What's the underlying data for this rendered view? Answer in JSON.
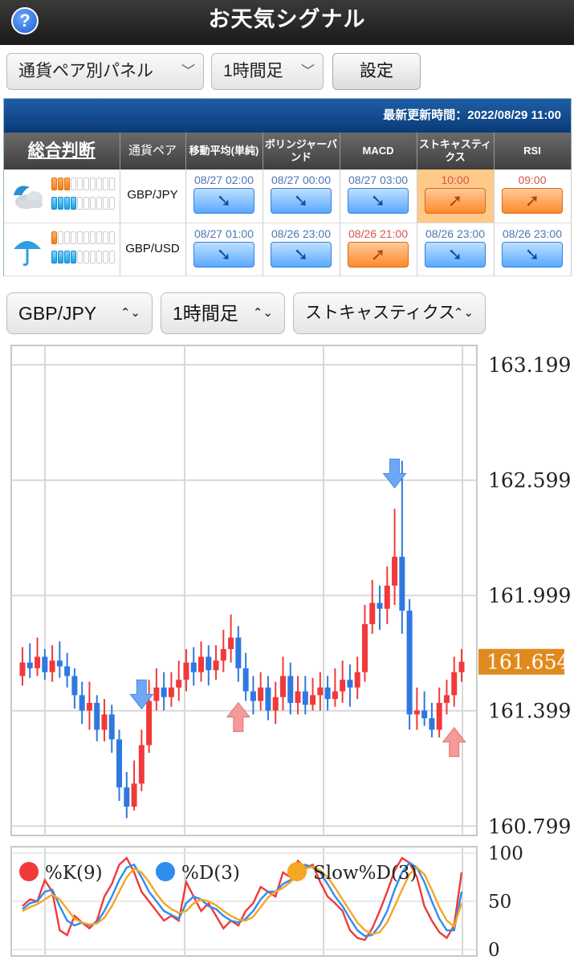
{
  "header": {
    "title": "お天気シグナル",
    "help_icon": "question-circle-icon",
    "help_glyph": "?"
  },
  "controls": {
    "view_select": "通貨ペア別パネル",
    "timeframe_select": "1時間足",
    "settings_label": "設定",
    "chevron": "﹀"
  },
  "panel": {
    "update_text": "最新更新時間：2022/08/29 11:00",
    "headers": [
      "総合判断",
      "通貨ペア",
      "移動平均(単純)",
      "ボリンジャーバンド",
      "MACD",
      "ストキャスティクス",
      "RSI"
    ],
    "rows": [
      {
        "weather": "cloudy-icon",
        "meter_orange": 3,
        "meter_blue": 4,
        "meter_total": 10,
        "pair": "GBP/JPY",
        "signals": [
          {
            "time": "08/27 02:00",
            "dir": "down",
            "highlight": false
          },
          {
            "time": "08/27 00:00",
            "dir": "down",
            "highlight": false
          },
          {
            "time": "08/27 03:00",
            "dir": "down",
            "highlight": false
          },
          {
            "time": "10:00",
            "dir": "up",
            "highlight": true
          },
          {
            "time": "09:00",
            "dir": "up",
            "highlight": false
          }
        ]
      },
      {
        "weather": "umbrella-icon",
        "meter_orange": 1,
        "meter_blue": 4,
        "meter_total": 10,
        "pair": "GBP/USD",
        "signals": [
          {
            "time": "08/27 01:00",
            "dir": "down",
            "highlight": false
          },
          {
            "time": "08/26 23:00",
            "dir": "down",
            "highlight": false
          },
          {
            "time": "08/26 21:00",
            "dir": "up",
            "highlight": false
          },
          {
            "time": "08/26 23:00",
            "dir": "down",
            "highlight": false
          },
          {
            "time": "08/26 23:00",
            "dir": "down",
            "highlight": false
          }
        ]
      }
    ],
    "arrow_down": "➘",
    "arrow_up": "➚"
  },
  "chart_controls": {
    "pair_select": "GBP/JPY",
    "timeframe_select": "1時間足",
    "indicator_select": "ストキャスティクス",
    "updown": "⌃⌄"
  },
  "colors": {
    "up": "#f03a3a",
    "down": "#2f78e0",
    "k_line": "#f03a3a",
    "d_line": "#2f8df0",
    "slow_d_line": "#f5a623",
    "current_price_bg": "#e08a1e"
  },
  "chart_data": [
    {
      "type": "candlestick",
      "title": "",
      "y_ticks": [
        163.199,
        162.599,
        161.999,
        161.399,
        160.799
      ],
      "ylim": [
        160.75,
        163.3
      ],
      "current_price": 161.654,
      "candles": [
        [
          161.58,
          161.65,
          161.53,
          161.73
        ],
        [
          161.65,
          161.62,
          161.57,
          161.75
        ],
        [
          161.62,
          161.68,
          161.58,
          161.78
        ],
        [
          161.68,
          161.6,
          161.56,
          161.72
        ],
        [
          161.6,
          161.66,
          161.55,
          161.74
        ],
        [
          161.66,
          161.63,
          161.57,
          161.76
        ],
        [
          161.63,
          161.58,
          161.52,
          161.7
        ],
        [
          161.58,
          161.48,
          161.41,
          161.62
        ],
        [
          161.48,
          161.4,
          161.33,
          161.55
        ],
        [
          161.4,
          161.44,
          161.3,
          161.55
        ],
        [
          161.44,
          161.3,
          161.24,
          161.48
        ],
        [
          161.3,
          161.38,
          161.24,
          161.46
        ],
        [
          161.38,
          161.25,
          161.18,
          161.43
        ],
        [
          161.25,
          161.0,
          160.93,
          161.3
        ],
        [
          161.0,
          160.9,
          160.84,
          161.08
        ],
        [
          160.9,
          161.02,
          160.88,
          161.14
        ],
        [
          161.02,
          161.22,
          160.98,
          161.3
        ],
        [
          161.22,
          161.45,
          161.18,
          161.56
        ],
        [
          161.45,
          161.52,
          161.4,
          161.62
        ],
        [
          161.52,
          161.47,
          161.4,
          161.6
        ],
        [
          161.47,
          161.52,
          161.42,
          161.6
        ],
        [
          161.52,
          161.56,
          161.45,
          161.66
        ],
        [
          161.56,
          161.65,
          161.5,
          161.72
        ],
        [
          161.65,
          161.6,
          161.53,
          161.73
        ],
        [
          161.6,
          161.68,
          161.55,
          161.76
        ],
        [
          161.68,
          161.61,
          161.53,
          161.74
        ],
        [
          161.61,
          161.66,
          161.56,
          161.74
        ],
        [
          161.66,
          161.72,
          161.6,
          161.82
        ],
        [
          161.72,
          161.78,
          161.65,
          161.9
        ],
        [
          161.78,
          161.62,
          161.55,
          161.84
        ],
        [
          161.62,
          161.5,
          161.45,
          161.7
        ],
        [
          161.5,
          161.45,
          161.38,
          161.58
        ],
        [
          161.45,
          161.52,
          161.4,
          161.6
        ],
        [
          161.52,
          161.4,
          161.35,
          161.58
        ],
        [
          161.4,
          161.47,
          161.33,
          161.55
        ],
        [
          161.47,
          161.58,
          161.4,
          161.68
        ],
        [
          161.58,
          161.44,
          161.38,
          161.65
        ],
        [
          161.44,
          161.5,
          161.38,
          161.58
        ],
        [
          161.5,
          161.43,
          161.38,
          161.58
        ],
        [
          161.43,
          161.48,
          161.4,
          161.57
        ],
        [
          161.48,
          161.52,
          161.4,
          161.6
        ],
        [
          161.52,
          161.46,
          161.4,
          161.58
        ],
        [
          161.46,
          161.5,
          161.42,
          161.62
        ],
        [
          161.5,
          161.56,
          161.44,
          161.66
        ],
        [
          161.56,
          161.52,
          161.42,
          161.64
        ],
        [
          161.52,
          161.6,
          161.46,
          161.68
        ],
        [
          161.6,
          161.85,
          161.55,
          161.95
        ],
        [
          161.85,
          161.96,
          161.8,
          162.08
        ],
        [
          161.96,
          161.93,
          161.82,
          162.05
        ],
        [
          161.93,
          162.05,
          161.85,
          162.15
        ],
        [
          162.05,
          162.2,
          161.95,
          162.45
        ],
        [
          162.2,
          161.92,
          161.8,
          162.7
        ],
        [
          161.92,
          161.38,
          161.3,
          161.98
        ],
        [
          161.38,
          161.4,
          161.3,
          161.52
        ],
        [
          161.4,
          161.36,
          161.32,
          161.5
        ],
        [
          161.36,
          161.3,
          161.26,
          161.44
        ],
        [
          161.3,
          161.44,
          161.26,
          161.52
        ],
        [
          161.44,
          161.48,
          161.38,
          161.56
        ],
        [
          161.48,
          161.6,
          161.42,
          161.68
        ],
        [
          161.6,
          161.654,
          161.55,
          161.72
        ]
      ],
      "annotations": [
        {
          "kind": "sell-arrow",
          "index": 16
        },
        {
          "kind": "sell-arrow",
          "index": 50
        },
        {
          "kind": "buy-arrow",
          "index": 29
        },
        {
          "kind": "buy-arrow",
          "index": 58
        }
      ]
    },
    {
      "type": "line",
      "title": "",
      "y_ticks": [
        100,
        50,
        0
      ],
      "ylim": [
        0,
        100
      ],
      "series": [
        {
          "name": "%K(9)",
          "values": [
            45,
            52,
            50,
            72,
            60,
            20,
            15,
            35,
            28,
            22,
            30,
            55,
            68,
            88,
            95,
            80,
            60,
            50,
            40,
            30,
            35,
            30,
            70,
            55,
            40,
            48,
            35,
            22,
            30,
            25,
            40,
            48,
            65,
            60,
            55,
            80,
            75,
            92,
            85,
            88,
            70,
            55,
            48,
            40,
            20,
            12,
            10,
            22,
            40,
            60,
            82,
            95,
            90,
            75,
            45,
            30,
            18,
            12,
            25,
            80
          ]
        },
        {
          "name": "%D(3)",
          "values": [
            42,
            48,
            50,
            60,
            62,
            45,
            30,
            25,
            28,
            25,
            28,
            40,
            55,
            72,
            85,
            88,
            75,
            60,
            50,
            40,
            36,
            32,
            48,
            55,
            52,
            45,
            42,
            35,
            30,
            28,
            32,
            40,
            52,
            60,
            60,
            68,
            72,
            82,
            88,
            85,
            80,
            68,
            55,
            45,
            32,
            20,
            14,
            15,
            25,
            40,
            62,
            80,
            90,
            85,
            70,
            50,
            32,
            20,
            20,
            60
          ]
        },
        {
          "name": "Slow%D(3)",
          "values": [
            40,
            44,
            47,
            52,
            57,
            52,
            42,
            32,
            28,
            26,
            27,
            33,
            45,
            60,
            75,
            84,
            80,
            70,
            58,
            48,
            42,
            38,
            40,
            48,
            52,
            50,
            46,
            40,
            35,
            31,
            30,
            34,
            44,
            54,
            60,
            64,
            70,
            78,
            84,
            86,
            82,
            75,
            64,
            52,
            40,
            28,
            20,
            16,
            18,
            28,
            45,
            62,
            78,
            85,
            78,
            62,
            44,
            30,
            24,
            48
          ]
        }
      ]
    }
  ]
}
